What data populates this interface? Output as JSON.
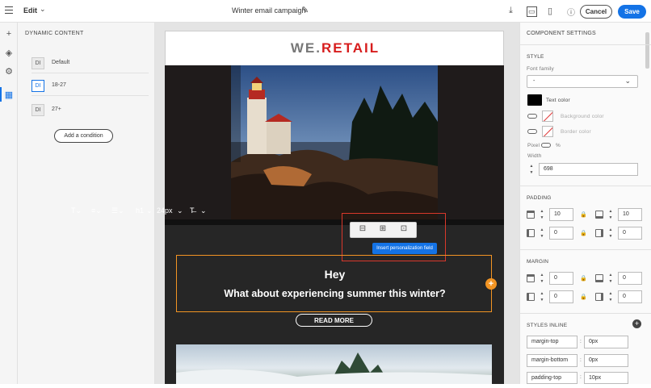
{
  "header": {
    "mode": "Edit",
    "title": "Winter email campaign",
    "cancel": "Cancel",
    "save": "Save"
  },
  "dynamic_content": {
    "title": "DYNAMIC CONTENT",
    "badge": "DI",
    "conditions": [
      "Default",
      "18-27",
      "27+"
    ],
    "add_condition": "Add a condition"
  },
  "email": {
    "brand_left": "WE.",
    "brand_right": "RETAIL",
    "heading": "Hey",
    "subheading": "What about experiencing summer this winter?",
    "cta": "READ MORE",
    "toolbar": {
      "heading_level": "h1",
      "font_size": "24px"
    },
    "tooltip": "Insert personalization field"
  },
  "settings": {
    "title": "COMPONENT SETTINGS",
    "style": "STYLE",
    "font_family": "Font family",
    "font_family_value": "-",
    "text_color": "Text color",
    "background_color": "Background color",
    "border_color": "Border color",
    "unit_pixel": "Pixel",
    "unit_percent": "%",
    "width_label": "Width",
    "width": "698",
    "padding": "PADDING",
    "padding_values": [
      "10",
      "10",
      "0",
      "0"
    ],
    "margin": "MARGIN",
    "margin_values": [
      "0",
      "0",
      "0",
      "0"
    ],
    "styles_inline": "STYLES INLINE",
    "inline": [
      {
        "prop": "margin-top",
        "sep": ":",
        "value": "0px"
      },
      {
        "prop": "margin-bottom",
        "sep": ":",
        "value": "0px"
      },
      {
        "prop": "padding-top",
        "sep": ":",
        "value": "10px"
      }
    ]
  },
  "colors": {
    "accent": "#1473e6",
    "selection": "#f29423",
    "highlight": "#d9382b",
    "brand": "#d71d1d"
  }
}
